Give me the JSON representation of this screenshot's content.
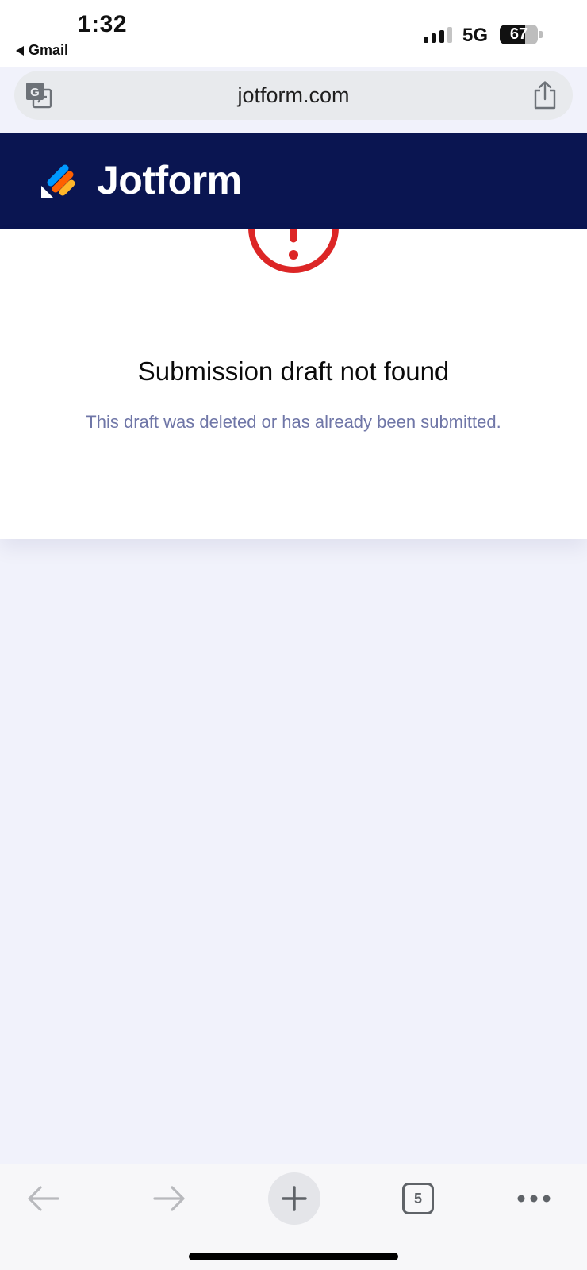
{
  "status_bar": {
    "time": "1:32",
    "back_app": "Gmail",
    "network": "5G",
    "battery_percent": 67,
    "battery_label": "67"
  },
  "address_bar": {
    "url": "jotform.com",
    "left_icon": "translate-icon",
    "right_icon": "share-icon"
  },
  "header": {
    "brand": "Jotform",
    "background": "#0a1551",
    "logo_colors": [
      "#0099ff",
      "#ff6100",
      "#ffb629",
      "#ffffff"
    ]
  },
  "error_card": {
    "icon": "alert-circle-icon",
    "icon_color": "#dc2626",
    "title": "Submission draft not found",
    "message": "This draft was deleted or has already been submitted."
  },
  "toolbar": {
    "items": [
      {
        "name": "back",
        "icon": "arrow-left-icon"
      },
      {
        "name": "forward",
        "icon": "arrow-right-icon"
      },
      {
        "name": "new-tab",
        "icon": "plus-icon"
      },
      {
        "name": "tabs",
        "icon": "tabs-icon",
        "count": "5"
      },
      {
        "name": "more",
        "icon": "more-horizontal-icon"
      }
    ]
  }
}
